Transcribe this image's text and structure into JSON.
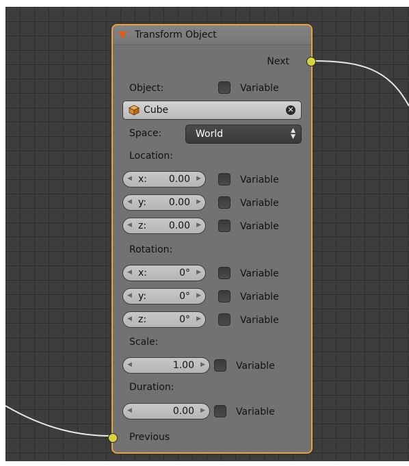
{
  "node": {
    "title": "Transform Object",
    "next_label": "Next",
    "previous_label": "Previous",
    "object_label": "Object:",
    "object_value": "Cube",
    "variable_label": "Variable",
    "space_label": "Space:",
    "space_value": "World",
    "location_label": "Location:",
    "location": [
      {
        "axis": "x:",
        "value": "0.00"
      },
      {
        "axis": "y:",
        "value": "0.00"
      },
      {
        "axis": "z:",
        "value": "0.00"
      }
    ],
    "rotation_label": "Rotation:",
    "rotation": [
      {
        "axis": "x:",
        "value": "0°"
      },
      {
        "axis": "y:",
        "value": "0°"
      },
      {
        "axis": "z:",
        "value": "0°"
      }
    ],
    "scale_label": "Scale:",
    "scale_value": "1.00",
    "duration_label": "Duration:",
    "duration_value": "0.00"
  },
  "icons": {
    "collapse": "triangle-down-icon",
    "object": "cube-icon",
    "clear": "clear-x-icon",
    "dropdown": "updown-arrows-icon"
  },
  "colors": {
    "node_border": "#e9a33b",
    "node_body": "#727272",
    "socket": "#d5d53f",
    "collapse_icon": "#e05a15",
    "grid_bg": "#3d3d3d"
  }
}
